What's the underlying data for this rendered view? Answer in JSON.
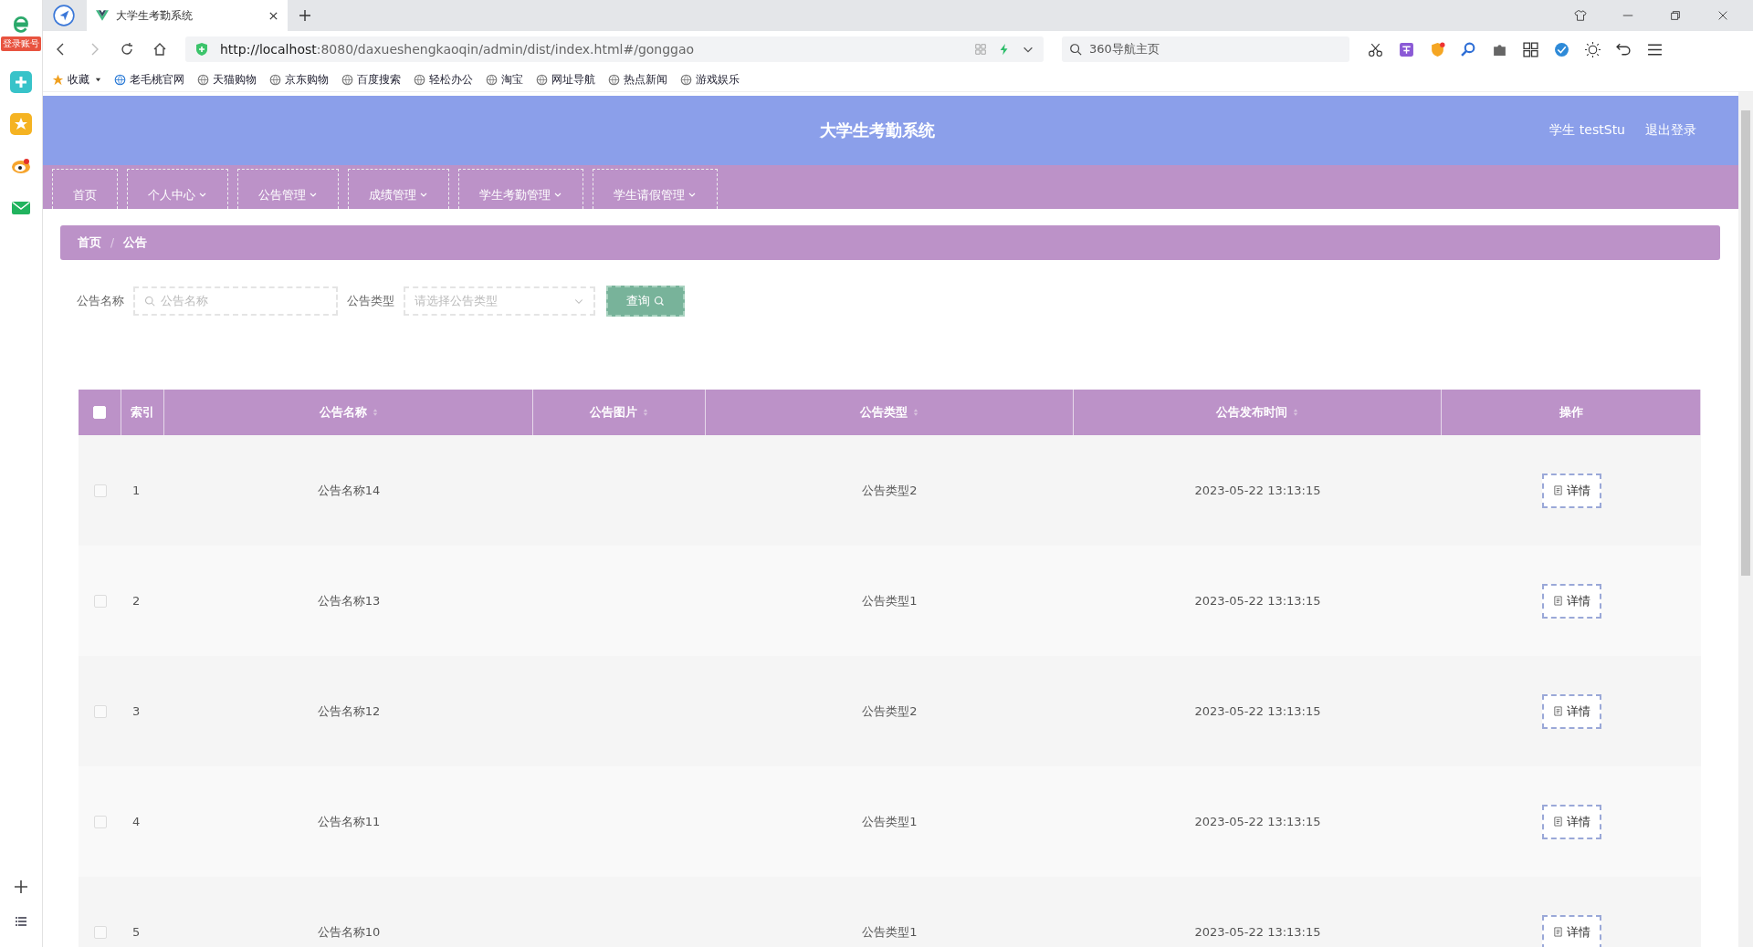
{
  "browser": {
    "login_badge": "登录账号",
    "tab": {
      "title": "大学生考勤系统"
    },
    "url": {
      "host": "http://localhost",
      "rest": ":8080/daxueshengkaoqin/admin/dist/index.html#/gonggao"
    },
    "search": {
      "placeholder": "360导航主页"
    },
    "bookmarks": [
      "收藏",
      "老毛桃官网",
      "天猫购物",
      "京东购物",
      "百度搜索",
      "轻松办公",
      "淘宝",
      "网址导航",
      "热点新闻",
      "游戏娱乐"
    ]
  },
  "header": {
    "title": "大学生考勤系统",
    "user": "学生 testStu",
    "logout": "退出登录"
  },
  "nav": [
    {
      "label": "首页",
      "dropdown": false
    },
    {
      "label": "个人中心",
      "dropdown": true
    },
    {
      "label": "公告管理",
      "dropdown": true
    },
    {
      "label": "成绩管理",
      "dropdown": true
    },
    {
      "label": "学生考勤管理",
      "dropdown": true
    },
    {
      "label": "学生请假管理",
      "dropdown": true
    }
  ],
  "breadcrumb": [
    "首页",
    "公告"
  ],
  "breadcrumb_separator": "/",
  "filters": [
    {
      "label": "公告名称",
      "placeholder": "公告名称",
      "kind": "text"
    },
    {
      "label": "公告类型",
      "placeholder": "请选择公告类型",
      "kind": "select"
    }
  ],
  "query_button": "查询",
  "table": {
    "select_all_checked": false,
    "columns": [
      {
        "label": "索引",
        "sortable": false
      },
      {
        "label": "公告名称",
        "sortable": true
      },
      {
        "label": "公告图片",
        "sortable": true
      },
      {
        "label": "公告类型",
        "sortable": true
      },
      {
        "label": "公告发布时间",
        "sortable": true
      },
      {
        "label": "操作",
        "sortable": false
      }
    ],
    "rows": [
      {
        "index": "1",
        "name": "公告名称14",
        "type": "公告类型2",
        "time": "2023-05-22 13:13:15",
        "action": "详情",
        "checked": false
      },
      {
        "index": "2",
        "name": "公告名称13",
        "type": "公告类型1",
        "time": "2023-05-22 13:13:15",
        "action": "详情",
        "checked": false
      },
      {
        "index": "3",
        "name": "公告名称12",
        "type": "公告类型2",
        "time": "2023-05-22 13:13:15",
        "action": "详情",
        "checked": false
      },
      {
        "index": "4",
        "name": "公告名称11",
        "type": "公告类型1",
        "time": "2023-05-22 13:13:15",
        "action": "详情",
        "checked": false
      },
      {
        "index": "5",
        "name": "公告名称10",
        "type": "公告类型1",
        "time": "2023-05-22 13:13:15",
        "action": "详情",
        "checked": false
      }
    ]
  }
}
